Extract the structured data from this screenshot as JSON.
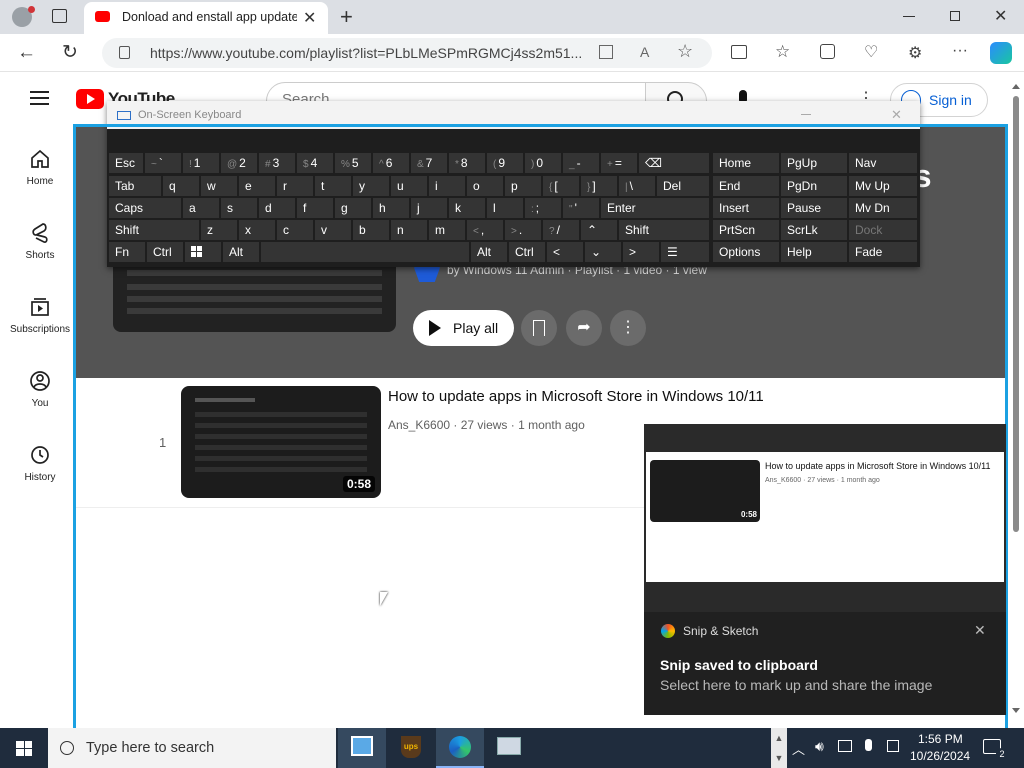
{
  "browser": {
    "tab_title": "Donload and enstall app updates",
    "url": "https://www.youtube.com/playlist?list=PLbLMeSPmRGMCj4ss2m51..."
  },
  "youtube": {
    "logo_text": "YouTube",
    "search_placeholder": "Search",
    "sign_in": "Sign in",
    "nav": [
      {
        "label": "Home"
      },
      {
        "label": "Shorts"
      },
      {
        "label": "Subscriptions"
      },
      {
        "label": "You"
      },
      {
        "label": "History"
      }
    ],
    "playlist_title_fragment": "es",
    "playlist_meta": "by Windows 11 Admin · Playlist · 1 video · 1 view",
    "play_all": "Play all",
    "video": {
      "index": "1",
      "title": "How to update apps in Microsoft Store in Windows 10/11",
      "meta": "Ans_K6600 · 27 views · 1 month ago",
      "duration": "0:58"
    }
  },
  "keyboard": {
    "title": "On-Screen Keyboard",
    "right_panel": [
      [
        "Home",
        "PgUp",
        "Nav"
      ],
      [
        "End",
        "PgDn",
        "Mv Up"
      ],
      [
        "Insert",
        "Pause",
        "Mv Dn"
      ],
      [
        "PrtScn",
        "ScrLk",
        "Dock"
      ],
      [
        "Options",
        "Help",
        "Fade"
      ]
    ]
  },
  "snip": {
    "app_name": "Snip & Sketch",
    "title": "Snip saved to clipboard",
    "subtitle": "Select here to mark up and share the image",
    "preview_title": "How to update apps in Microsoft Store in Windows 10/11",
    "preview_meta": "Ans_K6600 · 27 views · 1 month ago",
    "preview_duration": "0:58"
  },
  "taskbar": {
    "search_placeholder": "Type here to search",
    "time": "1:56 PM",
    "date": "10/26/2024",
    "notification_count": "2"
  },
  "colors": {
    "accent": "#1ba1e2",
    "youtube_red": "#ff0000",
    "link_blue": "#065fd4"
  }
}
